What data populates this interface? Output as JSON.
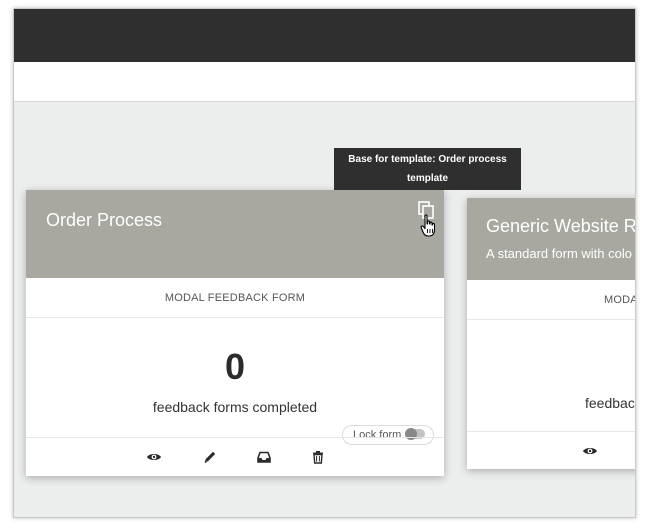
{
  "tooltip": {
    "line1": "Base for template: Order process",
    "line2": "template"
  },
  "cards": [
    {
      "title": "Order Process",
      "description": "",
      "type": "MODAL FEEDBACK FORM",
      "count": "0",
      "count_label": "feedback forms completed",
      "lock_label": "Lock form",
      "lock_on": false
    },
    {
      "title": "Generic Website Ra",
      "description": "A standard form with colo",
      "type": "MODAL",
      "count_label": "feedbac"
    }
  ],
  "icons": {
    "view": "eye-icon",
    "edit": "pencil-icon",
    "inbox": "inbox-icon",
    "delete": "trash-icon",
    "copy": "copy-icon"
  },
  "colors": {
    "header": "#2f2f2f",
    "card_head": "#a8a8a1",
    "background": "#eceeed"
  }
}
